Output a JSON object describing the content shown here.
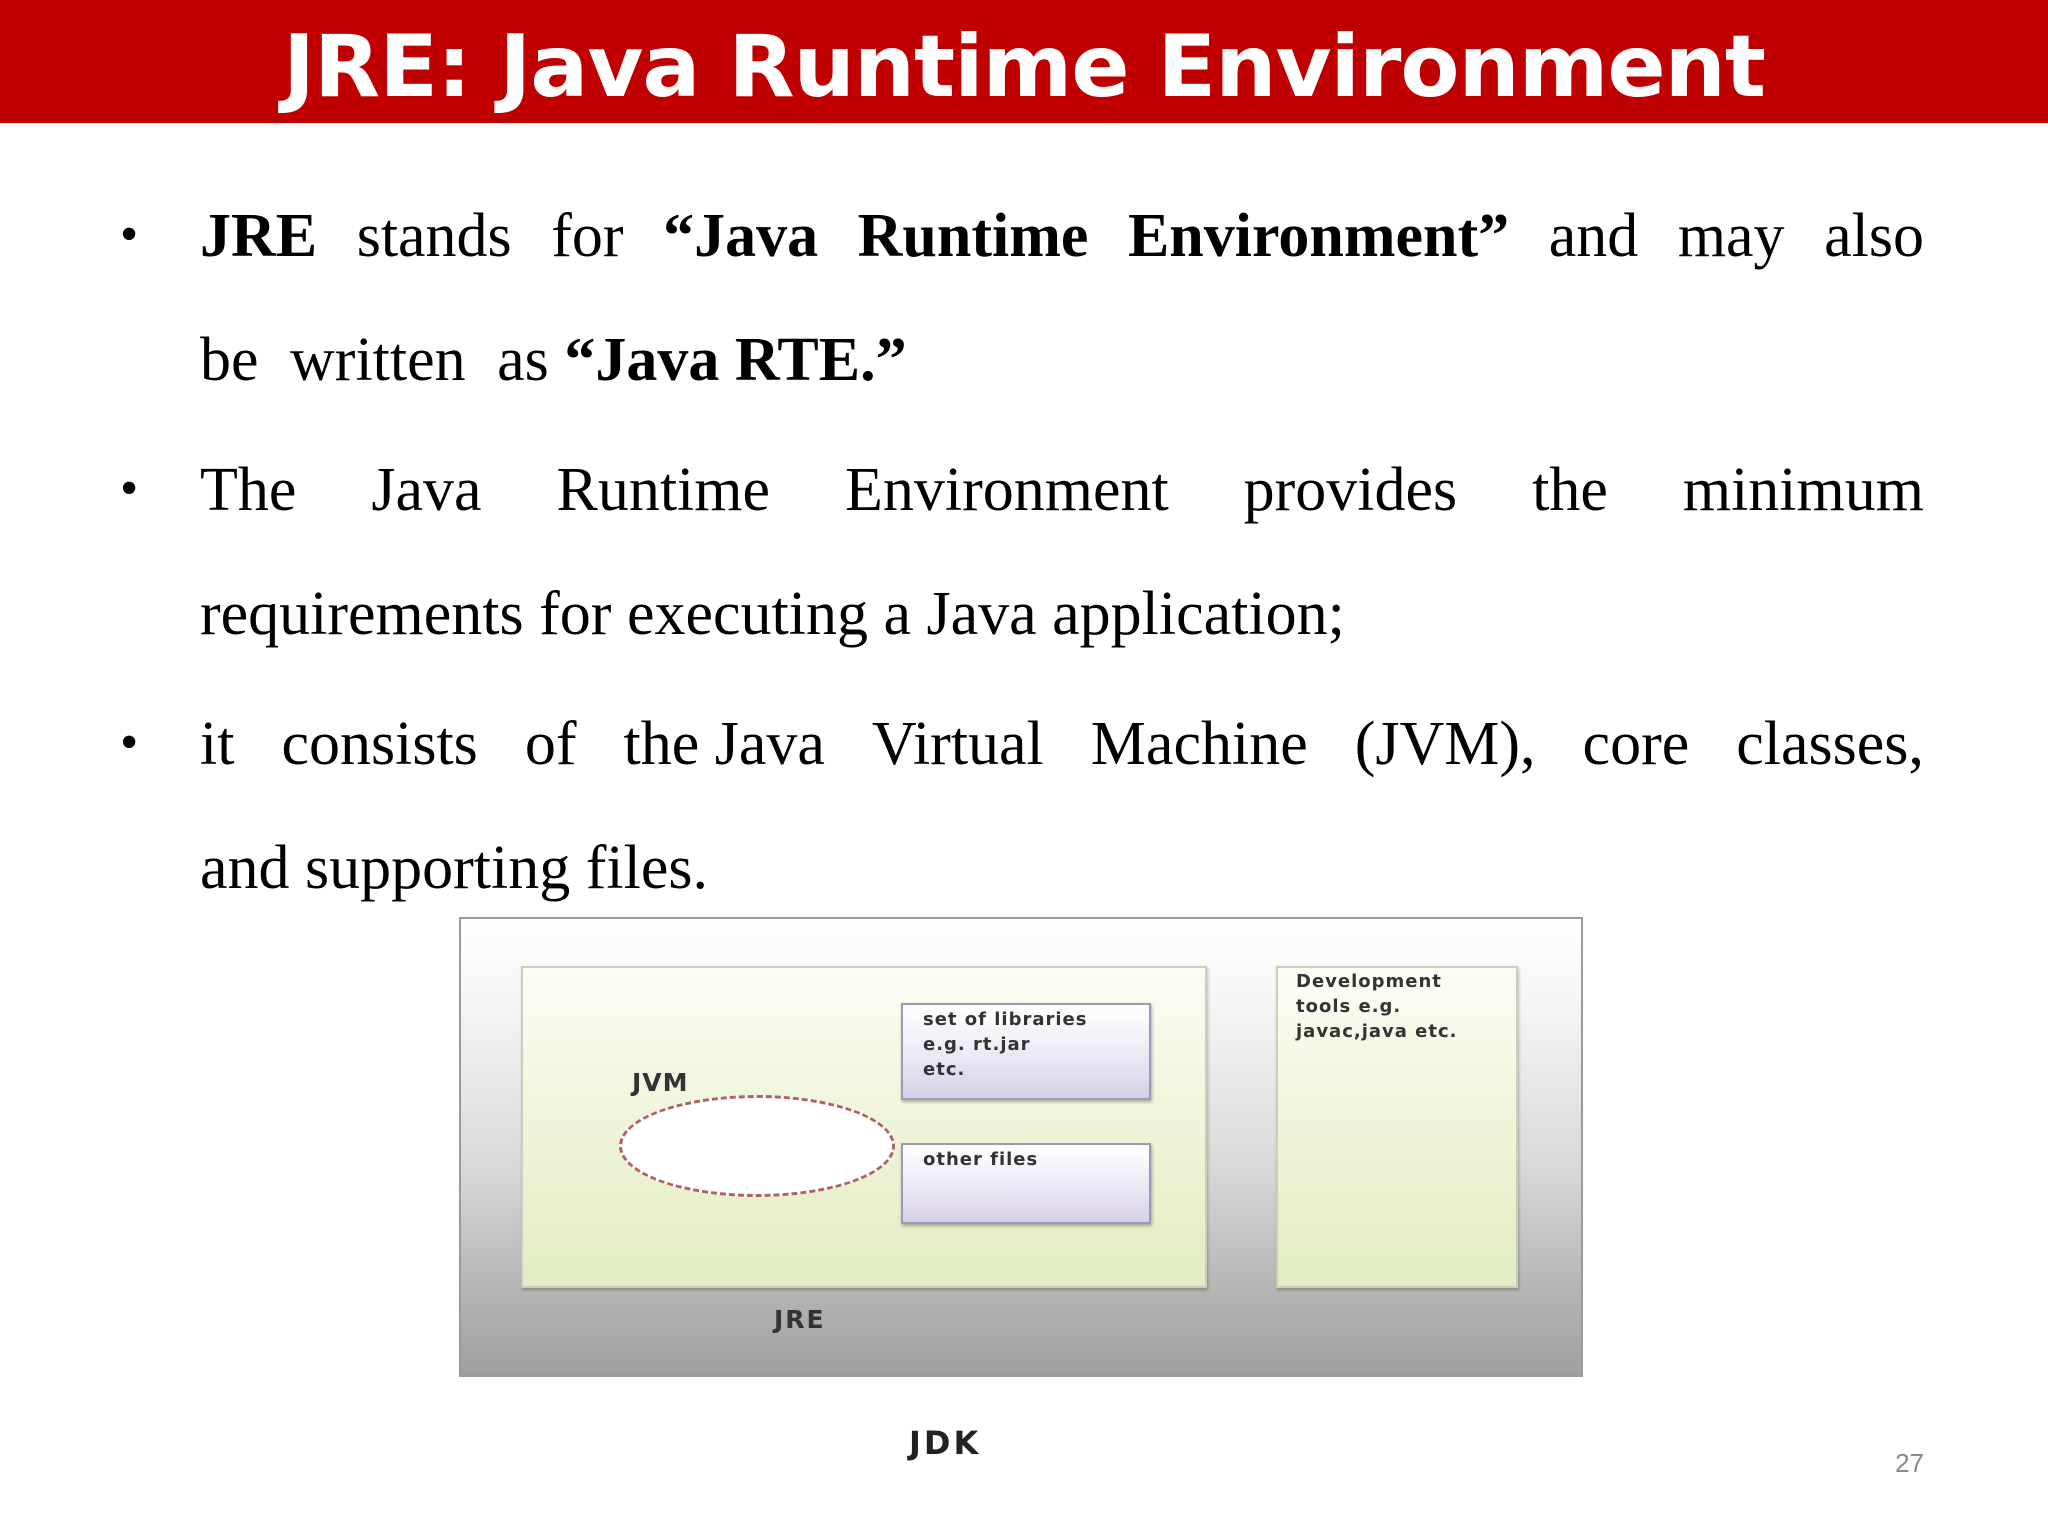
{
  "title": "JRE: Java Runtime Environment",
  "colors": {
    "title_bar": "#c00000",
    "title_text": "#ffffff"
  },
  "bullets": [
    {
      "lines": [
        [
          "JRE",
          "stands",
          "for",
          "“Java",
          "Runtime",
          "Environment”",
          "and",
          "may",
          "also"
        ],
        [
          "be",
          "written",
          "as",
          "“Java RTE.”"
        ]
      ]
    },
    {
      "lines": [
        [
          "The",
          "Java",
          "Runtime",
          "Environment",
          "provides",
          "the",
          "minimum"
        ],
        [
          "requirements for executing a Java application;"
        ]
      ]
    },
    {
      "lines": [
        [
          "it",
          "consists",
          "of",
          "the Java",
          "Virtual",
          "Machine",
          "(JVM),",
          "core",
          "classes,"
        ],
        [
          "and supporting files."
        ]
      ]
    }
  ],
  "diagram": {
    "jvm": "JVM",
    "libraries": "set of libraries\ne.g. rt.jar\netc.",
    "other_files": "other files",
    "dev_tools": "Development\ntools e.g.\njavac,java etc.",
    "jre": "JRE",
    "jdk": "JDK"
  },
  "page_number": "27"
}
